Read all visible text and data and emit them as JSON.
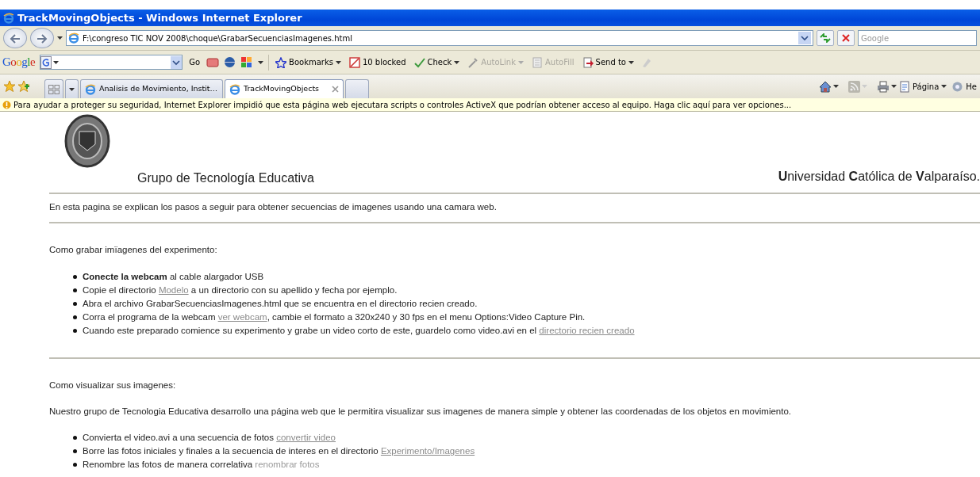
{
  "window": {
    "title": "TrackMovingObjects - Windows Internet Explorer"
  },
  "address_bar": {
    "url": "F:\\congreso TIC NOV 2008\\choque\\GrabarSecuenciasImagenes.html",
    "search_placeholder": "Google"
  },
  "google_toolbar": {
    "logo": "Google",
    "go_label": "Go",
    "buttons": [
      {
        "label": "Bookmarks",
        "dropdown": true,
        "disabled": false
      },
      {
        "label": "10 blocked",
        "dropdown": false,
        "disabled": false
      },
      {
        "label": "Check",
        "dropdown": true,
        "disabled": false
      },
      {
        "label": "AutoLink",
        "dropdown": true,
        "disabled": true
      },
      {
        "label": "AutoFill",
        "dropdown": false,
        "disabled": true
      },
      {
        "label": "Send to",
        "dropdown": true,
        "disabled": false
      }
    ]
  },
  "tabs": [
    {
      "label": "Analisis de Movimiento, Instit…",
      "selected": false
    },
    {
      "label": "TrackMovingObjects",
      "selected": true
    }
  ],
  "command_bar": {
    "page_label": "Página",
    "tools_label": "He"
  },
  "info_bar": {
    "text": "Para ayudar a proteger su seguridad, Internet Explorer impidió que esta página web ejecutara scripts o controles ActiveX que podrían obtener acceso al equipo. Haga clic aquí para ver opciones..."
  },
  "page": {
    "group_title": "Grupo de Tecnología Educativa",
    "university": "**U**niversidad **C**atólica de **V**alparaíso.",
    "intro": "En esta pagina se explican los pasos a seguir para obtener secuencias de imagenes usando una camara web.",
    "sections": [
      {
        "heading": "Como grabar imïagenes del experimento:",
        "items": [
          [
            {
              "kind": "text",
              "text": "**Conecte la webcam** al cable alargador USB"
            }
          ],
          [
            {
              "kind": "text",
              "text": "Copie el directorio "
            },
            {
              "kind": "link",
              "text": "Modelo"
            },
            {
              "kind": "text",
              "text": " a un directorio con su apellido y fecha por ejemplo."
            }
          ],
          [
            {
              "kind": "text",
              "text": "Abra el archivo GrabarSecuenciasImagenes.html que se encuentra en el directorio recien creado."
            }
          ],
          [
            {
              "kind": "text",
              "text": "Corra el programa de la webcam "
            },
            {
              "kind": "link",
              "text": "ver webcam"
            },
            {
              "kind": "text",
              "text": ", cambie el formato a 320x240 y 30 fps en el menu Options:Video Capture Pin."
            }
          ],
          [
            {
              "kind": "text",
              "text": "Cuando este preparado comience su experimento y grabe un video corto de este, guardelo como video.avi en el "
            },
            {
              "kind": "link",
              "text": "directorio recien creado"
            }
          ]
        ]
      },
      {
        "heading": "Como visualizar sus imagenes:",
        "paragraph": "Nuestro grupo de Tecnologia Educativa desarrollo una página web que le permitira visualizar sus imagenes de manera simple y obtener las coordenadas de los objetos en movimiento.",
        "items": [
          [
            {
              "kind": "text",
              "text": "Convierta el video.avi a una secuencia de fotos "
            },
            {
              "kind": "link",
              "text": "convertir video"
            }
          ],
          [
            {
              "kind": "text",
              "text": "Borre las fotos iniciales y finales a la secuencia de interes en el directorio "
            },
            {
              "kind": "link",
              "text": "Experimento/Imagenes"
            }
          ],
          [
            {
              "kind": "text",
              "text": "Renombre las fotos de manera correlativa "
            },
            {
              "kind": "plain-link",
              "text": "renombrar fotos"
            }
          ]
        ]
      }
    ]
  }
}
